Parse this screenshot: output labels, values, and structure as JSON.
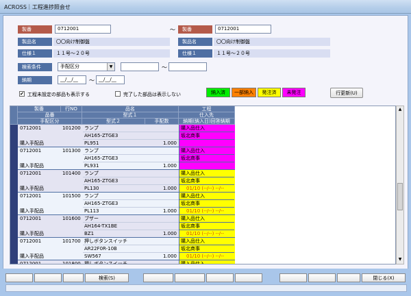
{
  "window": {
    "title": "ACROSS｜工程進捗照会せ"
  },
  "header": {
    "seiban_label": "製番",
    "seiban_from": "0712001",
    "tilde": "～",
    "seiban_to": "0712001",
    "hinmei_label": "製品名",
    "hinmei_left": "〇〇向け制御盤",
    "hinmei_right": "〇〇向け制御盤",
    "shiyou_label": "仕様１",
    "shiyou_left": "１１号～２０号",
    "shiyou_right": "１１号～２０号",
    "kensaku_label": "検索条件",
    "kensaku_select": "手配区分",
    "kensaku_tilde": "～",
    "nouki_label": "納期",
    "nouki_from": "__/__/__",
    "nouki_tilde": "～",
    "nouki_to": "__/__/__"
  },
  "options": {
    "show_unset_label": "工程未設定の部品も表示する",
    "show_unset_checked": "✔",
    "hide_done_label": "完了した部品は表示しない"
  },
  "legend": [
    {
      "label": "納入済",
      "color": "#00ee00"
    },
    {
      "label": "一部納入",
      "color": "#ff8000"
    },
    {
      "label": "発注済",
      "color": "#ffff00"
    },
    {
      "label": "未発注",
      "color": "#ff00ff"
    }
  ],
  "refresh_button": "行更新(U)",
  "grid": {
    "headers": {
      "r1": [
        "製番",
        "行NO",
        "品名",
        "工程"
      ],
      "r2": [
        "品番",
        "型式１",
        "仕入先"
      ],
      "r3": [
        "手配区分",
        "型式２",
        "手配数",
        "納期(納入日)回答納期"
      ]
    },
    "rows": [
      {
        "seiban": "0712001",
        "gyo": "101200",
        "hinmei": "ランプ",
        "kata1": "AH165-ZTGE3",
        "kubun": "購入手配品",
        "kata2": "PL951",
        "qty": "1.000",
        "p1": "購入品仕入",
        "p2": "坂北商事",
        "p3": "",
        "color": "#ff00ff"
      },
      {
        "seiban": "0712001",
        "gyo": "101300",
        "hinmei": "ランプ",
        "kata1": "AH165-ZTGE3",
        "kubun": "購入手配品",
        "kata2": "PL931",
        "qty": "1.000",
        "p1": "購入品仕入",
        "p2": "坂北商事",
        "p3": "",
        "color": "#ff00ff"
      },
      {
        "seiban": "0712001",
        "gyo": "101400",
        "hinmei": "ランプ",
        "kata1": "AH165-ZTGE3",
        "kubun": "購入手配品",
        "kata2": "PL130",
        "qty": "1.000",
        "p1": "購入品仕入",
        "p2": "坂北商事",
        "p3": "01/10 (--/--) --/--",
        "color": "#ffff00"
      },
      {
        "seiban": "0712001",
        "gyo": "101500",
        "hinmei": "ランプ",
        "kata1": "AH165-ZTGE3",
        "kubun": "購入手配品",
        "kata2": "PL113",
        "qty": "1.000",
        "p1": "購入品仕入",
        "p2": "坂北商事",
        "p3": "01/10 (--/--) --/--",
        "color": "#ffff00"
      },
      {
        "seiban": "0712001",
        "gyo": "101600",
        "hinmei": "ブザー",
        "kata1": "AH164-TX1BE",
        "kubun": "購入手配品",
        "kata2": "BZ1",
        "qty": "1.000",
        "p1": "購入品仕入",
        "p2": "坂北商事",
        "p3": "01/10 (--/--) --/--",
        "color": "#ffff00"
      },
      {
        "seiban": "0712001",
        "gyo": "101700",
        "hinmei": "押しボタンスイッチ",
        "kata1": "AR22F0R-10B",
        "kubun": "購入手配品",
        "kata2": "SW567",
        "qty": "1.000",
        "p1": "購入品仕入",
        "p2": "坂北商事",
        "p3": "01/10 (--/--) --/--",
        "color": "#ffff00"
      },
      {
        "seiban": "0712001",
        "gyo": "101800",
        "hinmei": "押しボタンスイッチ",
        "kata1": "",
        "kubun": "",
        "kata2": "",
        "qty": "",
        "p1": "購入品仕入",
        "p2": "",
        "p3": "",
        "color": "#ffff00"
      }
    ]
  },
  "footer": {
    "search_button": "検索(S)",
    "close_button": "閉じる(X)"
  }
}
